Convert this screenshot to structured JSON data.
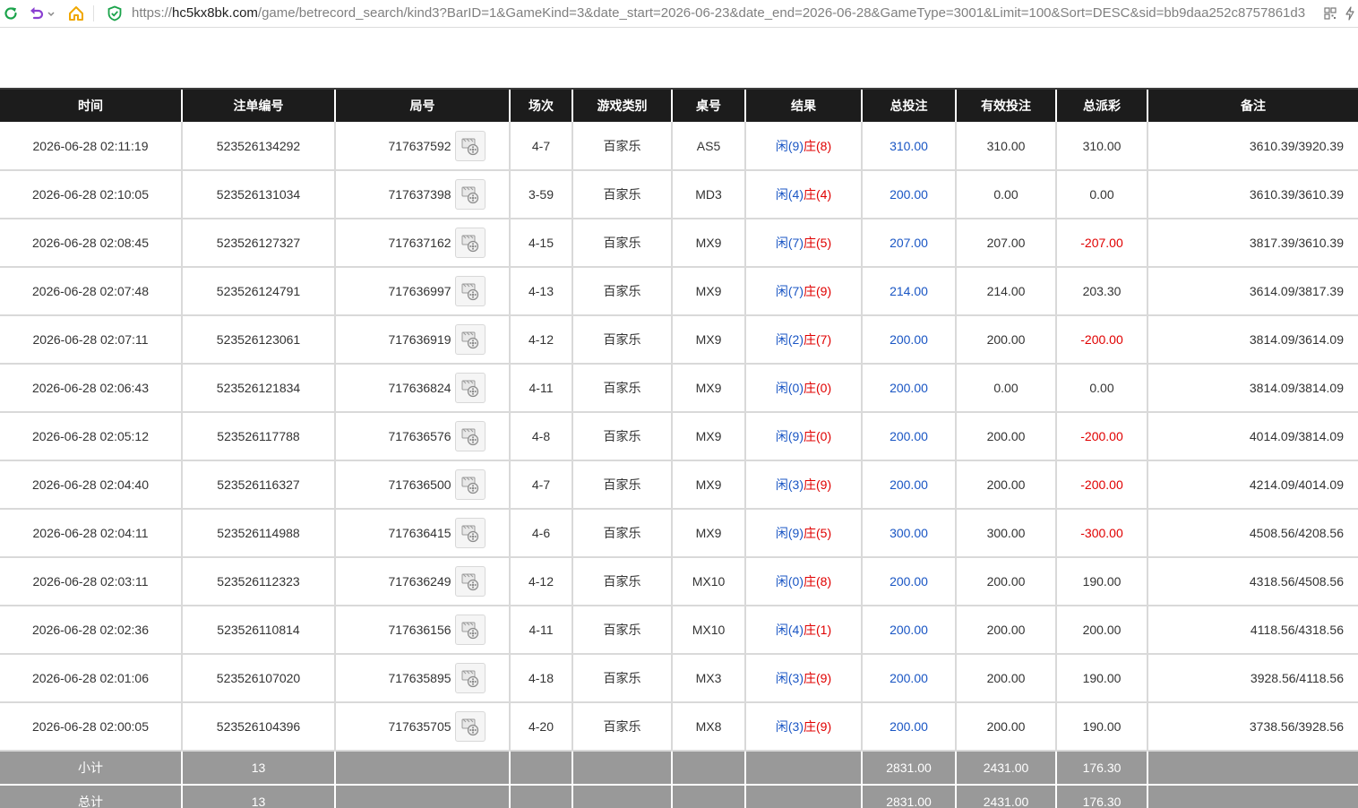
{
  "browser": {
    "url_scheme": "https://",
    "url_host": "hc5kx8bk.com",
    "url_path": "/game/betrecord_search/kind3?BarID=1&GameKind=3&date_start=2026-06-23&date_end=2026-06-28&GameType=3001&Limit=100&Sort=DESC&sid=bb9daa252c8757861d3"
  },
  "columns": [
    "时间",
    "注单编号",
    "局号",
    "场次",
    "游戏类别",
    "桌号",
    "结果",
    "总投注",
    "有效投注",
    "总派彩",
    "备注"
  ],
  "result_labels": {
    "idle": "闲",
    "bank": "庄"
  },
  "rows": [
    {
      "time": "2026-06-28 02:11:19",
      "bet_id": "523526134292",
      "round": "717637592",
      "set": "4-7",
      "game_type": "百家乐",
      "table": "AS5",
      "idle": "(9)",
      "bank": "(8)",
      "total_bet": "310.00",
      "valid_bet": "310.00",
      "payout": "310.00",
      "payout_negative": false,
      "remark": "3610.39/3920.39"
    },
    {
      "time": "2026-06-28 02:10:05",
      "bet_id": "523526131034",
      "round": "717637398",
      "set": "3-59",
      "game_type": "百家乐",
      "table": "MD3",
      "idle": "(4)",
      "bank": "(4)",
      "total_bet": "200.00",
      "valid_bet": "0.00",
      "payout": "0.00",
      "payout_negative": false,
      "remark": "3610.39/3610.39"
    },
    {
      "time": "2026-06-28 02:08:45",
      "bet_id": "523526127327",
      "round": "717637162",
      "set": "4-15",
      "game_type": "百家乐",
      "table": "MX9",
      "idle": "(7)",
      "bank": "(5)",
      "total_bet": "207.00",
      "valid_bet": "207.00",
      "payout": "-207.00",
      "payout_negative": true,
      "remark": "3817.39/3610.39"
    },
    {
      "time": "2026-06-28 02:07:48",
      "bet_id": "523526124791",
      "round": "717636997",
      "set": "4-13",
      "game_type": "百家乐",
      "table": "MX9",
      "idle": "(7)",
      "bank": "(9)",
      "total_bet": "214.00",
      "valid_bet": "214.00",
      "payout": "203.30",
      "payout_negative": false,
      "remark": "3614.09/3817.39"
    },
    {
      "time": "2026-06-28 02:07:11",
      "bet_id": "523526123061",
      "round": "717636919",
      "set": "4-12",
      "game_type": "百家乐",
      "table": "MX9",
      "idle": "(2)",
      "bank": "(7)",
      "total_bet": "200.00",
      "valid_bet": "200.00",
      "payout": "-200.00",
      "payout_negative": true,
      "remark": "3814.09/3614.09"
    },
    {
      "time": "2026-06-28 02:06:43",
      "bet_id": "523526121834",
      "round": "717636824",
      "set": "4-11",
      "game_type": "百家乐",
      "table": "MX9",
      "idle": "(0)",
      "bank": "(0)",
      "total_bet": "200.00",
      "valid_bet": "0.00",
      "payout": "0.00",
      "payout_negative": false,
      "remark": "3814.09/3814.09"
    },
    {
      "time": "2026-06-28 02:05:12",
      "bet_id": "523526117788",
      "round": "717636576",
      "set": "4-8",
      "game_type": "百家乐",
      "table": "MX9",
      "idle": "(9)",
      "bank": "(0)",
      "total_bet": "200.00",
      "valid_bet": "200.00",
      "payout": "-200.00",
      "payout_negative": true,
      "remark": "4014.09/3814.09"
    },
    {
      "time": "2026-06-28 02:04:40",
      "bet_id": "523526116327",
      "round": "717636500",
      "set": "4-7",
      "game_type": "百家乐",
      "table": "MX9",
      "idle": "(3)",
      "bank": "(9)",
      "total_bet": "200.00",
      "valid_bet": "200.00",
      "payout": "-200.00",
      "payout_negative": true,
      "remark": "4214.09/4014.09"
    },
    {
      "time": "2026-06-28 02:04:11",
      "bet_id": "523526114988",
      "round": "717636415",
      "set": "4-6",
      "game_type": "百家乐",
      "table": "MX9",
      "idle": "(9)",
      "bank": "(5)",
      "total_bet": "300.00",
      "valid_bet": "300.00",
      "payout": "-300.00",
      "payout_negative": true,
      "remark": "4508.56/4208.56"
    },
    {
      "time": "2026-06-28 02:03:11",
      "bet_id": "523526112323",
      "round": "717636249",
      "set": "4-12",
      "game_type": "百家乐",
      "table": "MX10",
      "idle": "(0)",
      "bank": "(8)",
      "total_bet": "200.00",
      "valid_bet": "200.00",
      "payout": "190.00",
      "payout_negative": false,
      "remark": "4318.56/4508.56"
    },
    {
      "time": "2026-06-28 02:02:36",
      "bet_id": "523526110814",
      "round": "717636156",
      "set": "4-11",
      "game_type": "百家乐",
      "table": "MX10",
      "idle": "(4)",
      "bank": "(1)",
      "total_bet": "200.00",
      "valid_bet": "200.00",
      "payout": "200.00",
      "payout_negative": false,
      "remark": "4118.56/4318.56"
    },
    {
      "time": "2026-06-28 02:01:06",
      "bet_id": "523526107020",
      "round": "717635895",
      "set": "4-18",
      "game_type": "百家乐",
      "table": "MX3",
      "idle": "(3)",
      "bank": "(9)",
      "total_bet": "200.00",
      "valid_bet": "200.00",
      "payout": "190.00",
      "payout_negative": false,
      "remark": "3928.56/4118.56"
    },
    {
      "time": "2026-06-28 02:00:05",
      "bet_id": "523526104396",
      "round": "717635705",
      "set": "4-20",
      "game_type": "百家乐",
      "table": "MX8",
      "idle": "(3)",
      "bank": "(9)",
      "total_bet": "200.00",
      "valid_bet": "200.00",
      "payout": "190.00",
      "payout_negative": false,
      "remark": "3738.56/3928.56"
    }
  ],
  "footer": [
    {
      "label": "小计",
      "count": "13",
      "total_bet": "2831.00",
      "valid_bet": "2431.00",
      "payout": "176.30"
    },
    {
      "label": "总计",
      "count": "13",
      "total_bet": "2831.00",
      "valid_bet": "2431.00",
      "payout": "176.30"
    }
  ],
  "colors": {
    "header_bg": "#1c1c1c",
    "footer_bg": "#999999",
    "blue": "#1a56c4",
    "red": "#e00000"
  }
}
